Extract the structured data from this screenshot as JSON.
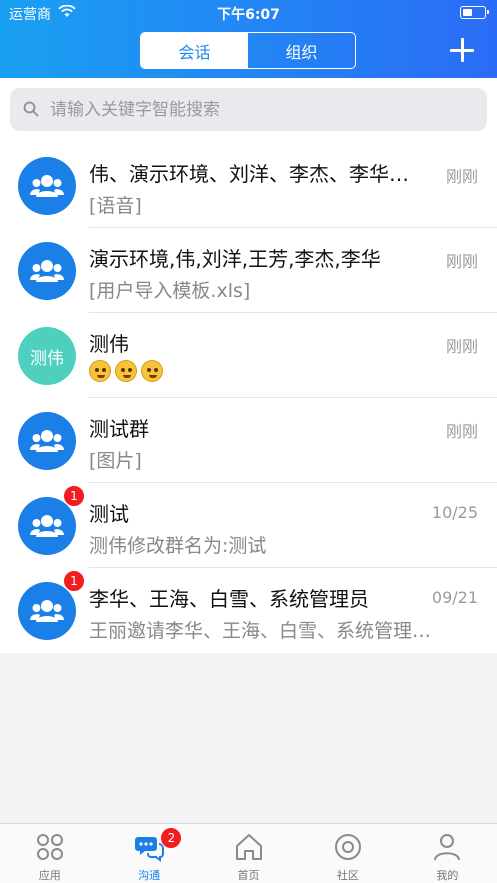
{
  "status_bar": {
    "carrier": "运营商",
    "time": "下午6:07"
  },
  "header": {
    "tabs": [
      "会话",
      "组织"
    ],
    "active_tab": "会话"
  },
  "search": {
    "placeholder": "请输入关键字智能搜索"
  },
  "conversations": [
    {
      "name": "伟、演示环境、刘洋、李杰、李华、王芳",
      "preview": "[语音]",
      "time": "刚刚",
      "avatar": "group-icon",
      "unread": ""
    },
    {
      "name": "演示环境,伟,刘洋,王芳,李杰,李华",
      "preview": "[用户导入模板.xls]",
      "time": "刚刚",
      "avatar": "group-icon",
      "unread": ""
    },
    {
      "name": "测伟",
      "preview": "",
      "time": "刚刚",
      "avatar_text": "测伟",
      "avatar_color": "#4fd0bf",
      "emojis": [
        "emoji-face",
        "emoji-face",
        "emoji-face"
      ],
      "unread": ""
    },
    {
      "name": "测试群",
      "preview": "[图片]",
      "time": "刚刚",
      "avatar": "group-icon",
      "unread": ""
    },
    {
      "name": "测试",
      "preview": "测伟修改群名为:测试",
      "time": "10/25",
      "avatar": "group-icon",
      "unread": "1"
    },
    {
      "name": "李华、王海、白雪、系统管理员",
      "preview": "王丽邀请李华、王海、白雪、系统管理员加入群聊",
      "time": "09/21",
      "avatar": "group-icon",
      "unread": "1"
    }
  ],
  "tabbar": {
    "items": [
      {
        "label": "应用",
        "icon": "apps-icon"
      },
      {
        "label": "沟通",
        "icon": "chat-icon",
        "badge": "2",
        "active": true
      },
      {
        "label": "首页",
        "icon": "home-icon"
      },
      {
        "label": "社区",
        "icon": "community-icon"
      },
      {
        "label": "我的",
        "icon": "profile-icon"
      }
    ]
  },
  "colors": {
    "accent": "#1a7fe6",
    "badge": "#f21d1d",
    "header_start": "#1aa0f2",
    "header_end": "#2b6cf6"
  }
}
